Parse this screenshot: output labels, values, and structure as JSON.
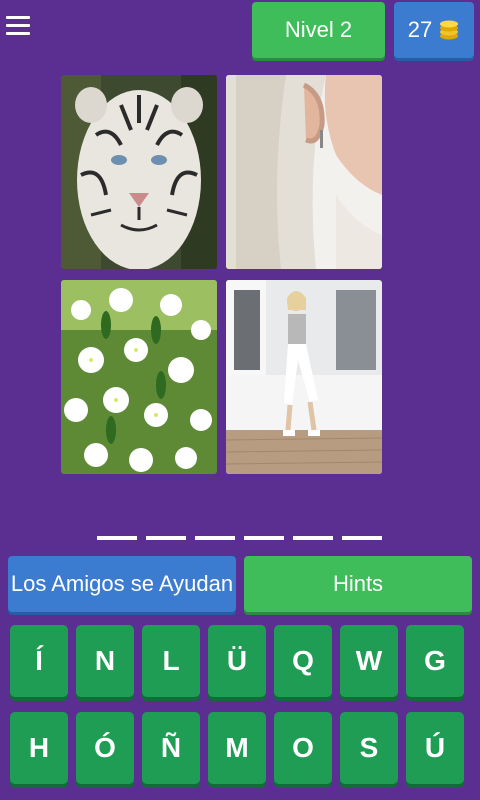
{
  "header": {
    "menu_icon": "hamburger-menu-icon",
    "level_label": "Nivel 2",
    "coins": "27",
    "coin_icon": "coin-stack-icon"
  },
  "answer": {
    "slot_count": 6
  },
  "actions": {
    "friends_label": "Los Amigos se Ayudan",
    "hints_label": "Hints"
  },
  "keyboard": {
    "row1": [
      "Í",
      "N",
      "L",
      "Ü",
      "Q",
      "W",
      "G"
    ],
    "row2": [
      "H",
      "Ó",
      "Ñ",
      "M",
      "O",
      "S",
      "Ú"
    ]
  },
  "colors": {
    "background": "#5b2e91",
    "green": "#3fbd5a",
    "blue": "#3b7bd0",
    "key_green": "#1f9d55"
  }
}
